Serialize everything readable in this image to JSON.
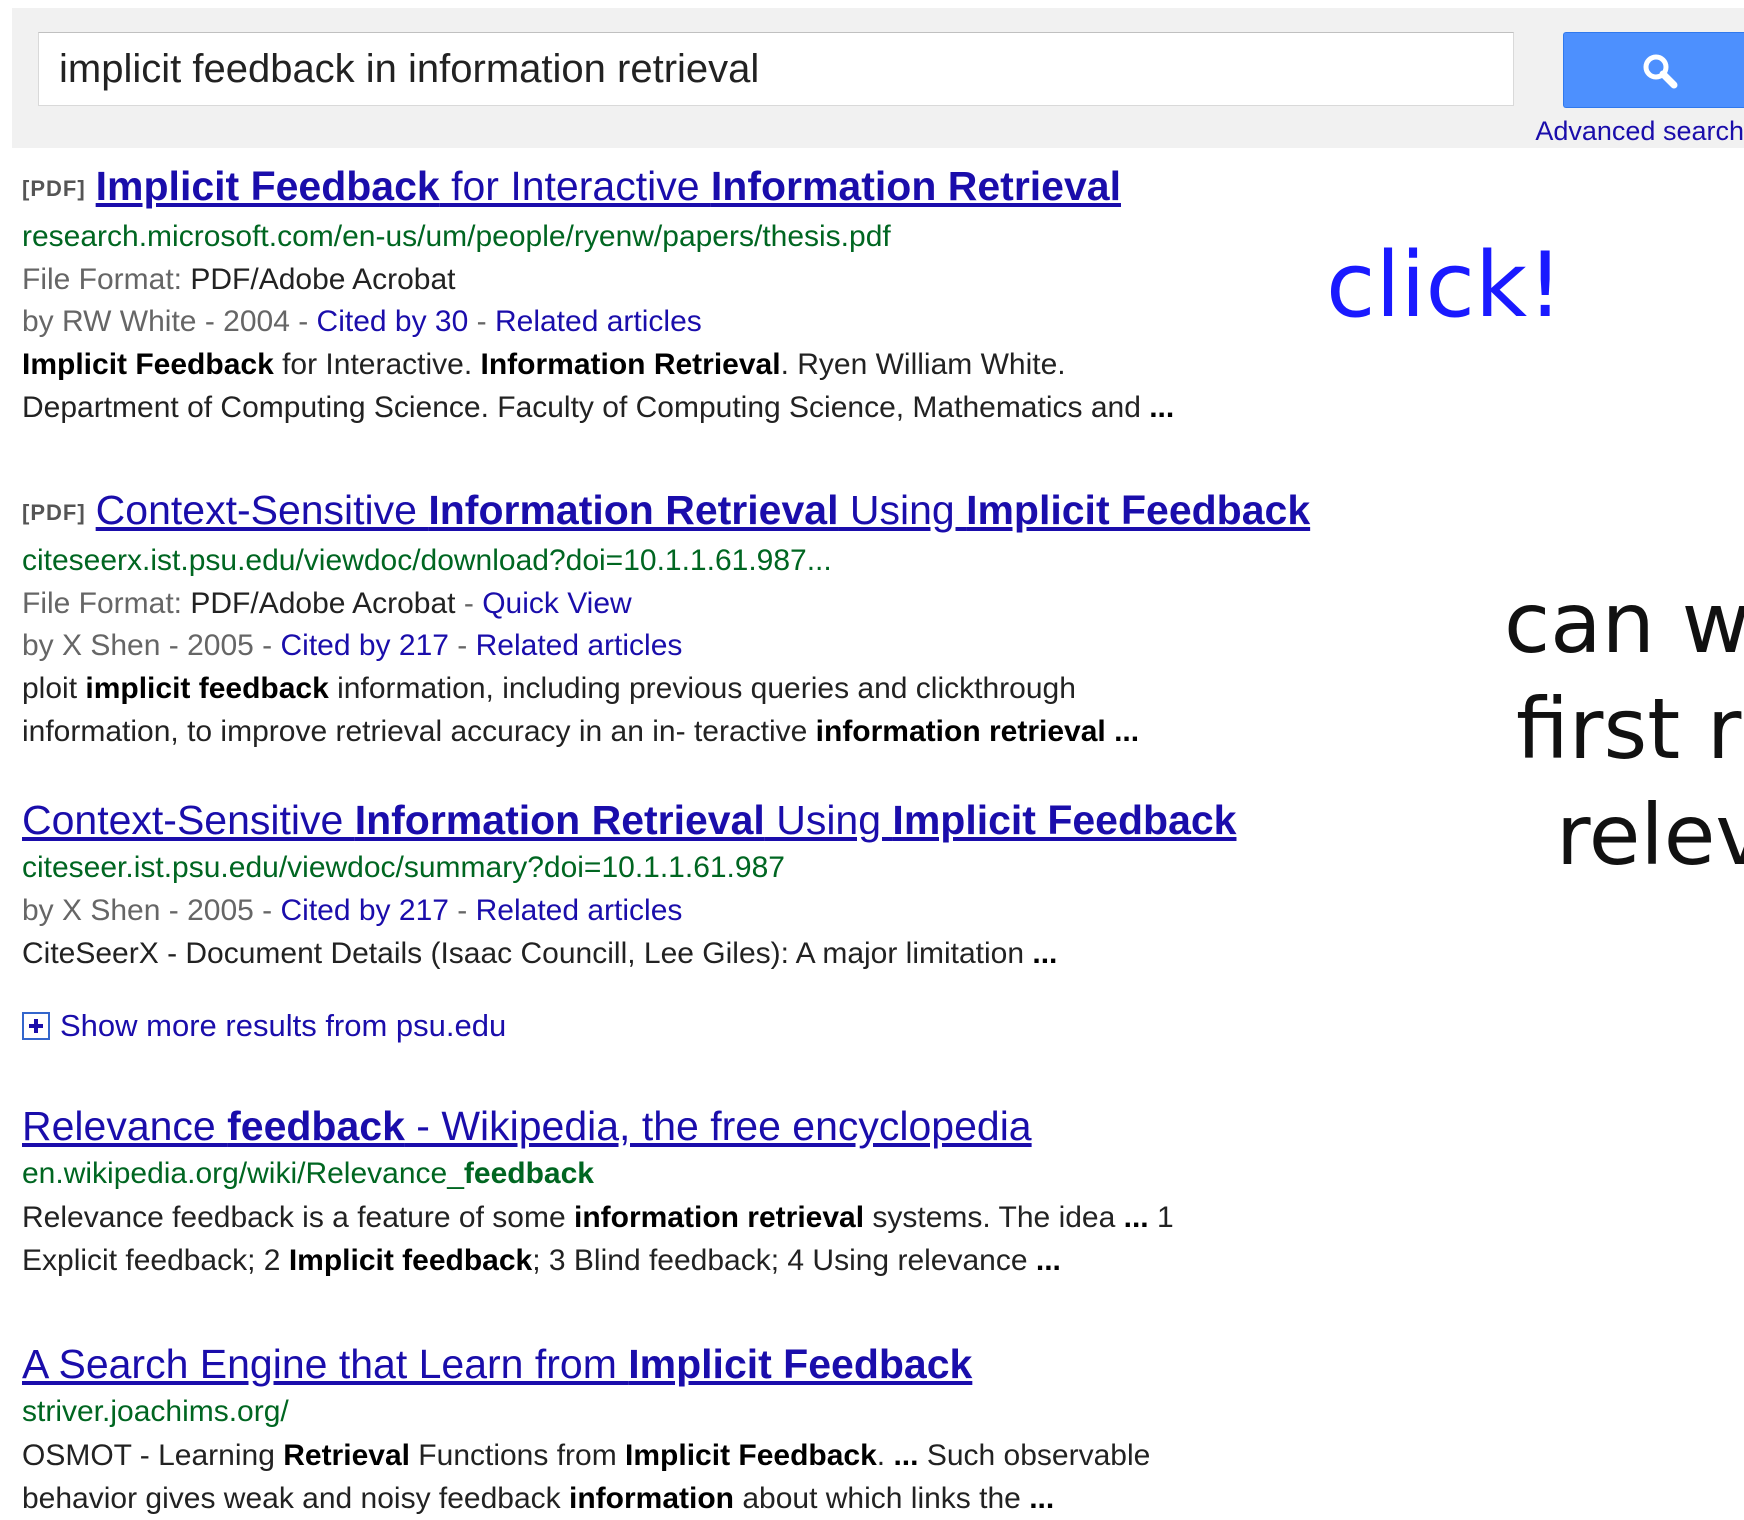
{
  "search": {
    "query": "implicit feedback in information retrieval",
    "advanced_search_label": "Advanced search"
  },
  "annotations": {
    "click": "click!",
    "side_lines": [
      "can w",
      "first r",
      "relev"
    ]
  },
  "colors": {
    "link": "#1a0dab",
    "url": "#006621",
    "button": "#4d90fe",
    "annotation_blue": "#1a1aff"
  },
  "results": [
    {
      "pdf_tag": "[PDF]",
      "title": [
        {
          "text": "Implicit Feedback",
          "bold": true
        },
        {
          "text": " for Interactive ",
          "bold": false
        },
        {
          "text": "Information Retrieval",
          "bold": true
        }
      ],
      "url": "research.microsoft.com/en-us/um/people/ryenw/papers/thesis.pdf",
      "file_format": {
        "label": "File Format: ",
        "value": "PDF/Adobe Acrobat"
      },
      "byline": "by RW White - 2004 - ",
      "cited_by": "Cited by 30",
      "related": "Related articles",
      "snippet": [
        [
          {
            "text": "Implicit Feedback",
            "bold": true
          },
          {
            "text": " for Interactive. ",
            "bold": false
          },
          {
            "text": "Information Retrieval",
            "bold": true
          },
          {
            "text": ". Ryen William White.",
            "bold": false
          }
        ],
        [
          {
            "text": "Department of Computing Science. Faculty of Computing Science, Mathematics and ",
            "bold": false
          },
          {
            "text": "...",
            "bold": true
          }
        ]
      ]
    },
    {
      "pdf_tag": "[PDF]",
      "title": [
        {
          "text": "Context-Sensitive ",
          "bold": false
        },
        {
          "text": "Information Retrieval",
          "bold": true
        },
        {
          "text": " Using ",
          "bold": false
        },
        {
          "text": "Implicit Feedback",
          "bold": true
        }
      ],
      "url": "citeseerx.ist.psu.edu/viewdoc/download?doi=10.1.1.61.987...",
      "file_format": {
        "label": "File Format: ",
        "value": "PDF/Adobe Acrobat"
      },
      "quick_view": "Quick View",
      "byline": "by X Shen - 2005 - ",
      "cited_by": "Cited by 217",
      "related": "Related articles",
      "snippet": [
        [
          {
            "text": "ploit ",
            "bold": false
          },
          {
            "text": "implicit feedback",
            "bold": true
          },
          {
            "text": " information, including previous queries and clickthrough",
            "bold": false
          }
        ],
        [
          {
            "text": "information, to improve retrieval accuracy in an in- teractive ",
            "bold": false
          },
          {
            "text": "information retrieval",
            "bold": true
          },
          {
            "text": " ...",
            "bold": true
          }
        ]
      ]
    },
    {
      "title": [
        {
          "text": "Context-Sensitive ",
          "bold": false
        },
        {
          "text": "Information Retrieval",
          "bold": true
        },
        {
          "text": " Using ",
          "bold": false
        },
        {
          "text": "Implicit Feedback",
          "bold": true
        }
      ],
      "url": "citeseer.ist.psu.edu/viewdoc/summary?doi=10.1.1.61.987",
      "byline": "by X Shen - 2005 - ",
      "cited_by": "Cited by 217",
      "related": "Related articles",
      "snippet": [
        [
          {
            "text": "CiteSeerX - Document Details (Isaac Councill, Lee Giles): A major limitation ",
            "bold": false
          },
          {
            "text": "...",
            "bold": true
          }
        ]
      ]
    },
    {
      "title": [
        {
          "text": "Relevance ",
          "bold": false
        },
        {
          "text": "feedback",
          "bold": true
        },
        {
          "text": " - Wikipedia, the free encyclopedia",
          "bold": false
        }
      ],
      "url_parts": [
        {
          "text": "en.wikipedia.org/wiki/Relevance_",
          "bold": false
        },
        {
          "text": "feedback",
          "bold": true
        }
      ],
      "snippet": [
        [
          {
            "text": "Relevance feedback is a feature of some ",
            "bold": false
          },
          {
            "text": "information retrieval",
            "bold": true
          },
          {
            "text": " systems. The idea ",
            "bold": false
          },
          {
            "text": "...",
            "bold": true
          },
          {
            "text": " 1",
            "bold": false
          }
        ],
        [
          {
            "text": "Explicit feedback; 2 ",
            "bold": false
          },
          {
            "text": "Implicit feedback",
            "bold": true
          },
          {
            "text": "; 3 Blind feedback; 4 Using relevance ",
            "bold": false
          },
          {
            "text": "...",
            "bold": true
          }
        ]
      ]
    },
    {
      "title": [
        {
          "text": "A Search Engine that Learn from ",
          "bold": false
        },
        {
          "text": "Implicit Feedback",
          "bold": true
        }
      ],
      "url": "striver.joachims.org/",
      "snippet": [
        [
          {
            "text": "OSMOT - Learning ",
            "bold": false
          },
          {
            "text": "Retrieval",
            "bold": true
          },
          {
            "text": " Functions from ",
            "bold": false
          },
          {
            "text": "Implicit Feedback",
            "bold": true
          },
          {
            "text": ". ",
            "bold": false
          },
          {
            "text": "...",
            "bold": true
          },
          {
            "text": " Such observable",
            "bold": false
          }
        ],
        [
          {
            "text": "behavior gives weak and noisy feedback ",
            "bold": false
          },
          {
            "text": "information",
            "bold": true
          },
          {
            "text": " about which links the ",
            "bold": false
          },
          {
            "text": "...",
            "bold": true
          }
        ]
      ]
    }
  ],
  "show_more": "Show more results from psu.edu"
}
